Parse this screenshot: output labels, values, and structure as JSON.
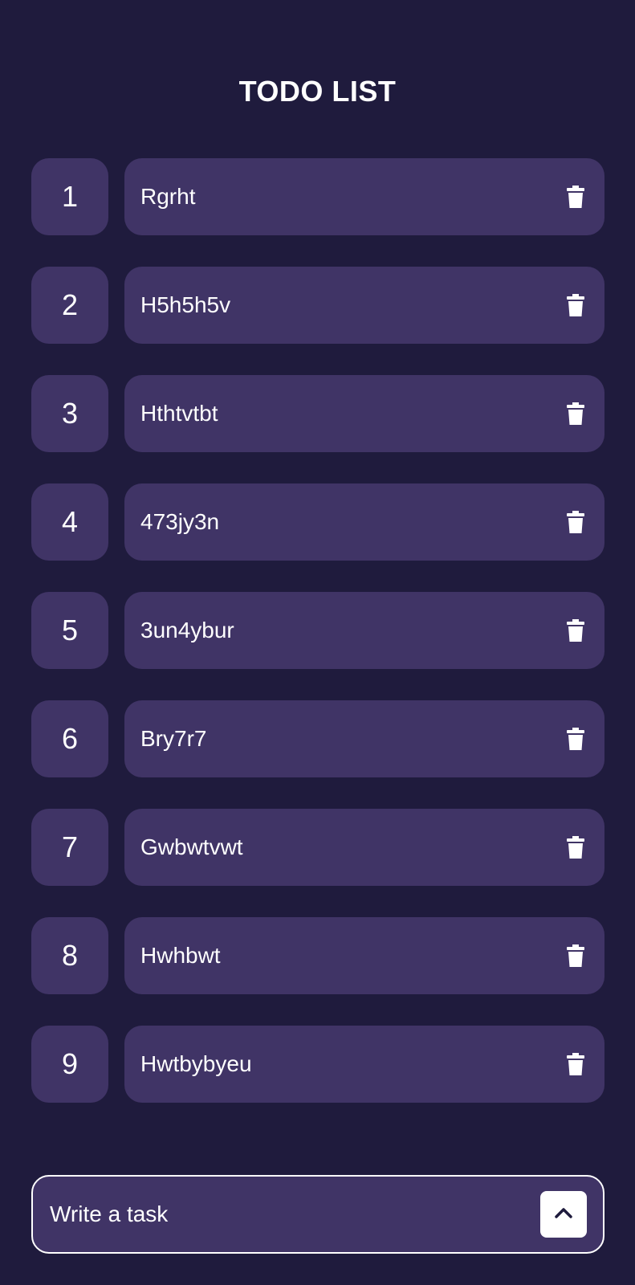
{
  "header": {
    "title": "TODO LIST"
  },
  "tasks": [
    {
      "number": "1",
      "text": "Rgrht"
    },
    {
      "number": "2",
      "text": "H5h5h5v"
    },
    {
      "number": "3",
      "text": "Hthtvtbt"
    },
    {
      "number": "4",
      "text": "473jy3n"
    },
    {
      "number": "5",
      "text": "3un4ybur"
    },
    {
      "number": "6",
      "text": "Bry7r7"
    },
    {
      "number": "7",
      "text": "Gwbwtvwt"
    },
    {
      "number": "8",
      "text": "Hwhbwt"
    },
    {
      "number": "9",
      "text": "Hwtbybyeu"
    }
  ],
  "icons": {
    "delete": "trash-icon",
    "add": "chevron-up-icon"
  },
  "input": {
    "placeholder": "Write a task",
    "value": ""
  },
  "colors": {
    "background": "#1f1b3d",
    "card": "#403466",
    "text": "#ffffff",
    "button": "#ffffff"
  }
}
